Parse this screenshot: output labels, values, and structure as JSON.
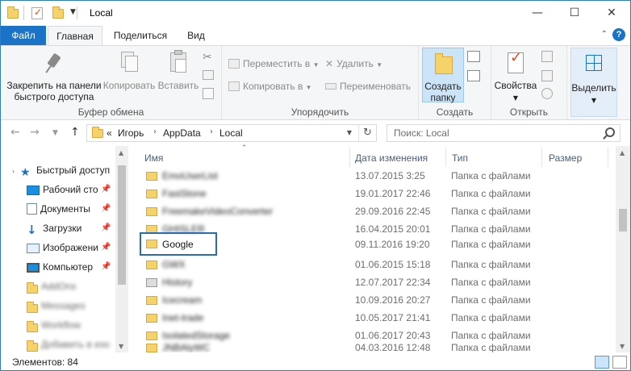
{
  "window": {
    "title": "Local",
    "minimize": "—",
    "maximize": "☐",
    "close": "✕"
  },
  "tabs": {
    "file": "Файл",
    "home": "Главная",
    "share": "Поделиться",
    "view": "Вид"
  },
  "ribbon": {
    "clipboard": {
      "label": "Буфер обмена",
      "pin": "Закрепить на панели быстрого доступа",
      "copy": "Копировать",
      "paste": "Вставить"
    },
    "organize": {
      "label": "Упорядочить",
      "move": "Переместить в",
      "copy_to": "Копировать в",
      "delete": "Удалить",
      "rename": "Переименовать"
    },
    "create": {
      "label": "Создать",
      "new_folder": "Создать папку"
    },
    "open": {
      "label": "Открыть",
      "properties": "Свойства"
    },
    "select": {
      "label": "Выделить"
    }
  },
  "address": {
    "overflow": "«",
    "crumbs": [
      "Игорь",
      "AppData",
      "Local"
    ],
    "search_placeholder": "Поиск: Local"
  },
  "nav": {
    "items": [
      {
        "label": "Быстрый доступ",
        "icon": "star-icon"
      },
      {
        "label": "Рабочий сто",
        "icon": "desktop-icon"
      },
      {
        "label": "Документы",
        "icon": "documents-icon"
      },
      {
        "label": "Загрузки",
        "icon": "downloads-icon"
      },
      {
        "label": "Изображени",
        "icon": "pictures-icon"
      },
      {
        "label": "Компьютер",
        "icon": "computer-icon"
      }
    ],
    "blurred": [
      "AddOns",
      "Messages",
      "Workflow",
      "Добавить в изо"
    ]
  },
  "columns": {
    "name": "Имя",
    "date": "Дата изменения",
    "type": "Тип",
    "size": "Размер"
  },
  "files": [
    {
      "name": "EmoUserList",
      "date": "13.07.2015 3:25",
      "type": "Папка с файлами",
      "blur": true
    },
    {
      "name": "FastStone",
      "date": "19.01.2017 22:46",
      "type": "Папка с файлами",
      "blur": true
    },
    {
      "name": "FreemakeVideoConverter",
      "date": "29.09.2016 22:45",
      "type": "Папка с файлами",
      "blur": true
    },
    {
      "name": "GHISLER",
      "date": "16.04.2015 20:01",
      "type": "Папка с файлами",
      "blur": true
    },
    {
      "name": "Google",
      "date": "09.11.2016 19:20",
      "type": "Папка с файлами",
      "blur": false
    },
    {
      "name": "GWX",
      "date": "01.06.2015 15:18",
      "type": "Папка с файлами",
      "blur": true
    },
    {
      "name": "History",
      "date": "12.07.2017 22:34",
      "type": "Папка с файлами",
      "blur": true
    },
    {
      "name": "Icecream",
      "date": "10.09.2016 20:27",
      "type": "Папка с файлами",
      "blur": true
    },
    {
      "name": "Inet-trade",
      "date": "10.05.2017 21:41",
      "type": "Папка с файлами",
      "blur": true
    },
    {
      "name": "IsolatedStorage",
      "date": "01.06.2017 20:43",
      "type": "Папка с файлами",
      "blur": true
    },
    {
      "name": "JNBAlyWC",
      "date": "04.03.2016 12:48",
      "type": "Папка с файлами",
      "blur": true
    }
  ],
  "status": {
    "items": "Элементов: 84"
  }
}
